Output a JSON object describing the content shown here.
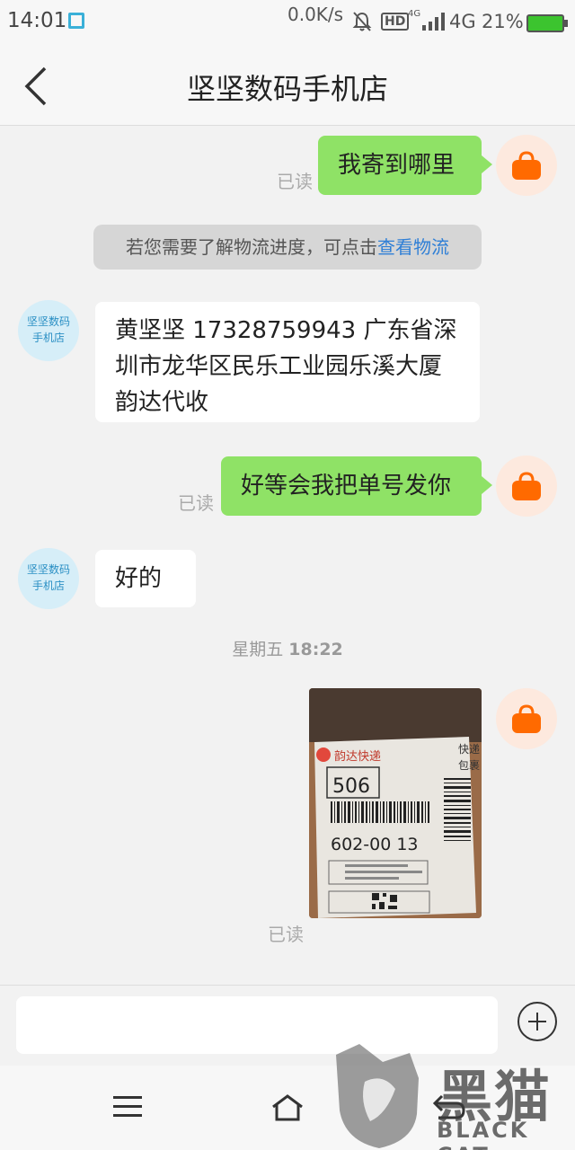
{
  "status_bar": {
    "time": "14:01",
    "net_speed": "0.0K/s",
    "hd_label": "HD",
    "signal_tag": "4G",
    "network": "4G",
    "battery": "21%"
  },
  "header": {
    "title": "坚坚数码手机店"
  },
  "shop": {
    "avatar_text_line1": "坚坚数码",
    "avatar_text_line2": "手机店"
  },
  "messages": [
    {
      "from": "me",
      "text": "我寄到哪里",
      "read": "已读"
    },
    {
      "from": "system",
      "text": "若您需要了解物流进度，可点击",
      "link": "查看物流"
    },
    {
      "from": "shop",
      "text": "黄坚坚  17328759943   广东省深圳市龙华区民乐工业园乐溪大厦韵达代收"
    },
    {
      "from": "me",
      "text": "好等会我把单号发你",
      "read": "已读"
    },
    {
      "from": "shop",
      "text": "好的"
    },
    {
      "from": "timestamp",
      "day": "星期五",
      "time": "18:22"
    },
    {
      "from": "me",
      "type": "image",
      "read": "已读",
      "image_texts": {
        "brand": "韵达快递",
        "code1": "506",
        "code2": "602-00 13",
        "corner": "快递",
        "corner2": "包裹"
      }
    }
  ],
  "input": {
    "placeholder": ""
  },
  "watermark": {
    "text": "黑猫",
    "sub": "BLACK CAT"
  },
  "colors": {
    "my_bubble": "#8fe266",
    "link": "#2f7fd6",
    "bag": "#ff6a00"
  },
  "icons": {
    "back": "chevron-left-icon",
    "bag": "shopping-bag-icon",
    "plus": "plus-circle-icon",
    "menu": "menu-icon",
    "home": "home-icon",
    "back_nav": "back-icon"
  }
}
